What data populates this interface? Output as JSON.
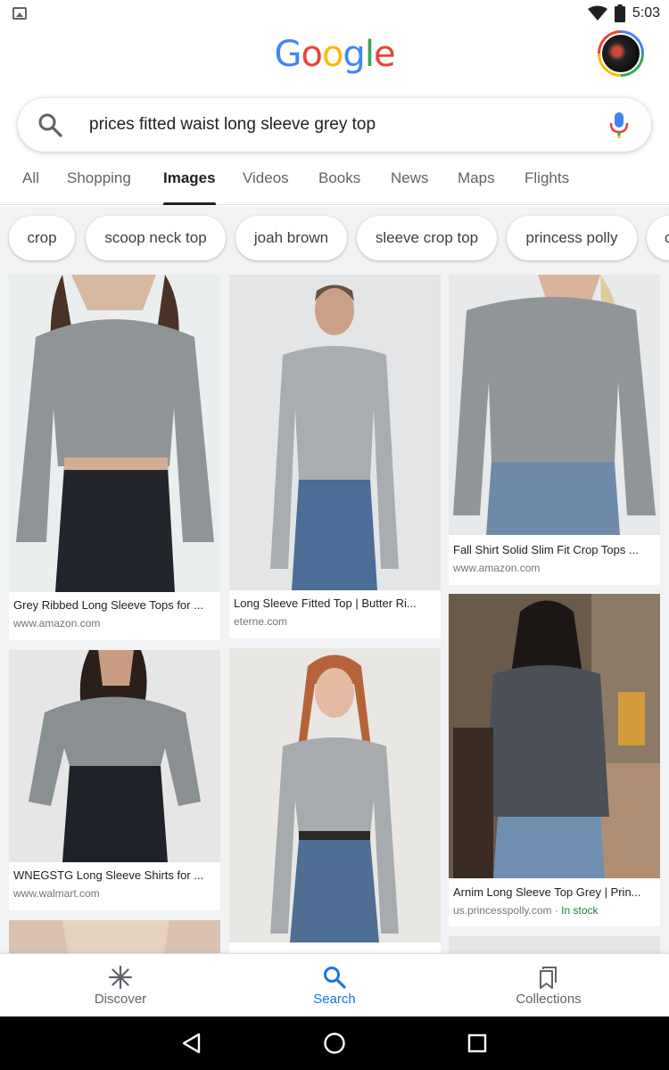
{
  "status_bar": {
    "time": "5:03"
  },
  "header": {
    "logo_letters": [
      {
        "char": "G",
        "color": "#4285f4"
      },
      {
        "char": "o",
        "color": "#ea4335"
      },
      {
        "char": "o",
        "color": "#fbbc05"
      },
      {
        "char": "g",
        "color": "#4285f4"
      },
      {
        "char": "l",
        "color": "#34a853"
      },
      {
        "char": "e",
        "color": "#ea4335"
      }
    ]
  },
  "search": {
    "query": "prices fitted waist long sleeve grey top"
  },
  "tabs": [
    {
      "label": "All"
    },
    {
      "label": "Shopping"
    },
    {
      "label": "Images",
      "active": true
    },
    {
      "label": "Videos"
    },
    {
      "label": "Books"
    },
    {
      "label": "News"
    },
    {
      "label": "Maps"
    },
    {
      "label": "Flights"
    }
  ],
  "chips": [
    {
      "label": "crop"
    },
    {
      "label": "scoop neck top"
    },
    {
      "label": "joah brown"
    },
    {
      "label": "sleeve crop top"
    },
    {
      "label": "princess polly"
    },
    {
      "label": "c"
    }
  ],
  "results": [
    {
      "caption": "Grey Ribbed Long Sleeve Tops for ...",
      "domain": "www.amazon.com"
    },
    {
      "caption": "Long Sleeve Fitted Top | Butter Ri...",
      "domain": "eterne.com"
    },
    {
      "caption": "Fall Shirt Solid Slim Fit Crop Tops ...",
      "domain": "www.amazon.com"
    },
    {
      "caption": "WNEGSTG Long Sleeve Shirts for ...",
      "domain": "www.walmart.com"
    },
    {
      "caption": "",
      "domain": ""
    },
    {
      "caption": "Arnim Long Sleeve Top Grey | Prin...",
      "domain": "us.princesspolly.com",
      "separator": " · ",
      "stock": "In stock"
    }
  ],
  "bottom_nav": [
    {
      "label": "Discover",
      "icon": "asterisk-icon"
    },
    {
      "label": "Search",
      "icon": "search-icon",
      "active": true
    },
    {
      "label": "Collections",
      "icon": "bookmark-icon"
    }
  ],
  "colors": {
    "accent": "#1a73e8",
    "in_stock": "#188038"
  }
}
